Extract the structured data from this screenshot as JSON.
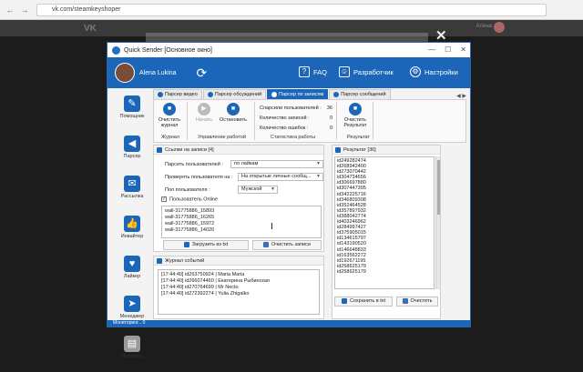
{
  "browser": {
    "url": "vk.com/steamkeyshoper",
    "user": "Алена"
  },
  "vk": {
    "logo": "VK"
  },
  "window": {
    "title": "Quick Sender [Основное окно]",
    "min": "—",
    "max": "☐",
    "close": "✕"
  },
  "header": {
    "user_name": "Alena Lukina",
    "faq": "FAQ",
    "developer": "Разработчик",
    "settings": "Настройки"
  },
  "sidebar": [
    {
      "label": "Помощник"
    },
    {
      "label": "Парсер"
    },
    {
      "label": "Рассылка"
    },
    {
      "label": "Инвайтер"
    },
    {
      "label": "Лайкер"
    },
    {
      "label": "Менеджер"
    },
    {
      "label": "Профиль"
    }
  ],
  "tabs": [
    {
      "label": "Парсер видео"
    },
    {
      "label": "Парсер обсуждений"
    },
    {
      "label": "Парсер по записям"
    },
    {
      "label": "Парсер сообщений"
    }
  ],
  "ribbon": {
    "clear_log": "Очистить журнал",
    "start": "Начать",
    "stop": "Остановить",
    "group_log": "Журнал",
    "group_control": "Управление работой",
    "group_stats": "Статистика работы",
    "clear_result": "Очистить Результат",
    "group_result": "Результат",
    "stats": [
      {
        "label": "Спарсили пользователей :",
        "value": "36"
      },
      {
        "label": "Количество записей :",
        "value": "0"
      },
      {
        "label": "Количество ошибок :",
        "value": "0"
      }
    ]
  },
  "links_panel": {
    "title": "Ссылки на записи [4]",
    "parse_label": "Парсить пользователей :",
    "parse_value": "по лайкам",
    "check_label": "Проверять пользователя на :",
    "check_value": "На открытые личные сообщ...",
    "gender_label": "Пол пользователя :",
    "gender_value": "Мужской",
    "online_label": "Пользователь Online",
    "links": [
      "wall-31775886_15893",
      "wall-31775886_16265",
      "wall-31775886_15972",
      "wall-31775886_14026"
    ],
    "load_btn": "Загрузить из txt",
    "clear_btn": "Очистить записи"
  },
  "log_panel": {
    "title": "Журнал событий",
    "entries": [
      "[17:44:40] id263750924 | Maria Maria",
      "[17:44:40] id266074460 | Екатерина Рыбинская",
      "[17:44:40] id270764699 | Mr Necto",
      "[17:44:40] id272392274 | Yulia Zhigalko"
    ]
  },
  "result_panel": {
    "title": "Результат [36]",
    "ids": [
      "id249282474",
      "id268942400",
      "id273070442",
      "id304734656",
      "id306697880",
      "id307447395",
      "id342225716",
      "id346809308",
      "id352464528",
      "id357897932",
      "id388042774",
      "id403246962",
      "id284997427",
      "id375905015",
      "id134615797",
      "id143190520",
      "id146648833",
      "id163562272",
      "id192671195",
      "id258625179",
      "id258625179"
    ],
    "save_btn": "Сохранить в txt",
    "clear_btn": "Очистить"
  },
  "status": {
    "text": "Мониторинг... 0"
  }
}
